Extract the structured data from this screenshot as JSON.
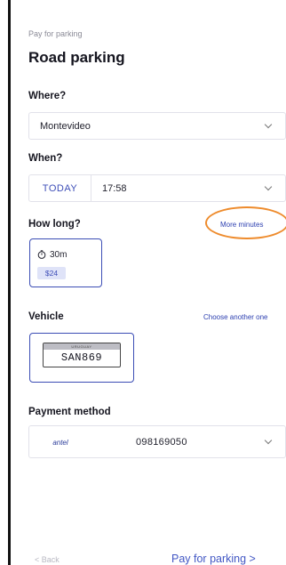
{
  "header": {
    "eyebrow": "Pay for parking",
    "title": "Road parking"
  },
  "where": {
    "label": "Where?",
    "value": "Montevideo"
  },
  "when": {
    "label": "When?",
    "today_label": "TODAY",
    "time": "17:58"
  },
  "how_long": {
    "label": "How long?",
    "more_link": "More minutes",
    "duration": "30m",
    "price": "$24"
  },
  "vehicle": {
    "label": "Vehicle",
    "change_link": "Choose another one",
    "plate_country": "URUGUAY",
    "plate_number": "SAN869"
  },
  "payment": {
    "label": "Payment method",
    "provider": "antel",
    "phone": "098169050"
  },
  "footer": {
    "back_label": "< Back",
    "pay_label": "Pay for parking >"
  },
  "colors": {
    "accent": "#3b4db5",
    "highlight": "#ee8b2c"
  }
}
